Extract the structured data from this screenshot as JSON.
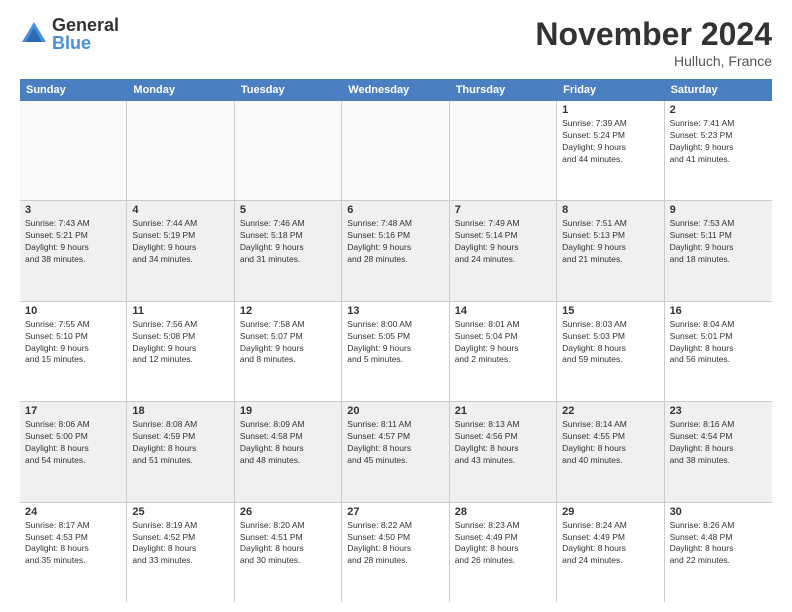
{
  "logo": {
    "general": "General",
    "blue": "Blue"
  },
  "title": "November 2024",
  "location": "Hulluch, France",
  "days_header": [
    "Sunday",
    "Monday",
    "Tuesday",
    "Wednesday",
    "Thursday",
    "Friday",
    "Saturday"
  ],
  "rows": [
    [
      {
        "day": "",
        "info": "",
        "empty": true
      },
      {
        "day": "",
        "info": "",
        "empty": true
      },
      {
        "day": "",
        "info": "",
        "empty": true
      },
      {
        "day": "",
        "info": "",
        "empty": true
      },
      {
        "day": "",
        "info": "",
        "empty": true
      },
      {
        "day": "1",
        "info": "Sunrise: 7:39 AM\nSunset: 5:24 PM\nDaylight: 9 hours\nand 44 minutes."
      },
      {
        "day": "2",
        "info": "Sunrise: 7:41 AM\nSunset: 5:23 PM\nDaylight: 9 hours\nand 41 minutes."
      }
    ],
    [
      {
        "day": "3",
        "info": "Sunrise: 7:43 AM\nSunset: 5:21 PM\nDaylight: 9 hours\nand 38 minutes."
      },
      {
        "day": "4",
        "info": "Sunrise: 7:44 AM\nSunset: 5:19 PM\nDaylight: 9 hours\nand 34 minutes."
      },
      {
        "day": "5",
        "info": "Sunrise: 7:46 AM\nSunset: 5:18 PM\nDaylight: 9 hours\nand 31 minutes."
      },
      {
        "day": "6",
        "info": "Sunrise: 7:48 AM\nSunset: 5:16 PM\nDaylight: 9 hours\nand 28 minutes."
      },
      {
        "day": "7",
        "info": "Sunrise: 7:49 AM\nSunset: 5:14 PM\nDaylight: 9 hours\nand 24 minutes."
      },
      {
        "day": "8",
        "info": "Sunrise: 7:51 AM\nSunset: 5:13 PM\nDaylight: 9 hours\nand 21 minutes."
      },
      {
        "day": "9",
        "info": "Sunrise: 7:53 AM\nSunset: 5:11 PM\nDaylight: 9 hours\nand 18 minutes."
      }
    ],
    [
      {
        "day": "10",
        "info": "Sunrise: 7:55 AM\nSunset: 5:10 PM\nDaylight: 9 hours\nand 15 minutes."
      },
      {
        "day": "11",
        "info": "Sunrise: 7:56 AM\nSunset: 5:08 PM\nDaylight: 9 hours\nand 12 minutes."
      },
      {
        "day": "12",
        "info": "Sunrise: 7:58 AM\nSunset: 5:07 PM\nDaylight: 9 hours\nand 8 minutes."
      },
      {
        "day": "13",
        "info": "Sunrise: 8:00 AM\nSunset: 5:05 PM\nDaylight: 9 hours\nand 5 minutes."
      },
      {
        "day": "14",
        "info": "Sunrise: 8:01 AM\nSunset: 5:04 PM\nDaylight: 9 hours\nand 2 minutes."
      },
      {
        "day": "15",
        "info": "Sunrise: 8:03 AM\nSunset: 5:03 PM\nDaylight: 8 hours\nand 59 minutes."
      },
      {
        "day": "16",
        "info": "Sunrise: 8:04 AM\nSunset: 5:01 PM\nDaylight: 8 hours\nand 56 minutes."
      }
    ],
    [
      {
        "day": "17",
        "info": "Sunrise: 8:06 AM\nSunset: 5:00 PM\nDaylight: 8 hours\nand 54 minutes."
      },
      {
        "day": "18",
        "info": "Sunrise: 8:08 AM\nSunset: 4:59 PM\nDaylight: 8 hours\nand 51 minutes."
      },
      {
        "day": "19",
        "info": "Sunrise: 8:09 AM\nSunset: 4:58 PM\nDaylight: 8 hours\nand 48 minutes."
      },
      {
        "day": "20",
        "info": "Sunrise: 8:11 AM\nSunset: 4:57 PM\nDaylight: 8 hours\nand 45 minutes."
      },
      {
        "day": "21",
        "info": "Sunrise: 8:13 AM\nSunset: 4:56 PM\nDaylight: 8 hours\nand 43 minutes."
      },
      {
        "day": "22",
        "info": "Sunrise: 8:14 AM\nSunset: 4:55 PM\nDaylight: 8 hours\nand 40 minutes."
      },
      {
        "day": "23",
        "info": "Sunrise: 8:16 AM\nSunset: 4:54 PM\nDaylight: 8 hours\nand 38 minutes."
      }
    ],
    [
      {
        "day": "24",
        "info": "Sunrise: 8:17 AM\nSunset: 4:53 PM\nDaylight: 8 hours\nand 35 minutes."
      },
      {
        "day": "25",
        "info": "Sunrise: 8:19 AM\nSunset: 4:52 PM\nDaylight: 8 hours\nand 33 minutes."
      },
      {
        "day": "26",
        "info": "Sunrise: 8:20 AM\nSunset: 4:51 PM\nDaylight: 8 hours\nand 30 minutes."
      },
      {
        "day": "27",
        "info": "Sunrise: 8:22 AM\nSunset: 4:50 PM\nDaylight: 8 hours\nand 28 minutes."
      },
      {
        "day": "28",
        "info": "Sunrise: 8:23 AM\nSunset: 4:49 PM\nDaylight: 8 hours\nand 26 minutes."
      },
      {
        "day": "29",
        "info": "Sunrise: 8:24 AM\nSunset: 4:49 PM\nDaylight: 8 hours\nand 24 minutes."
      },
      {
        "day": "30",
        "info": "Sunrise: 8:26 AM\nSunset: 4:48 PM\nDaylight: 8 hours\nand 22 minutes."
      }
    ]
  ]
}
